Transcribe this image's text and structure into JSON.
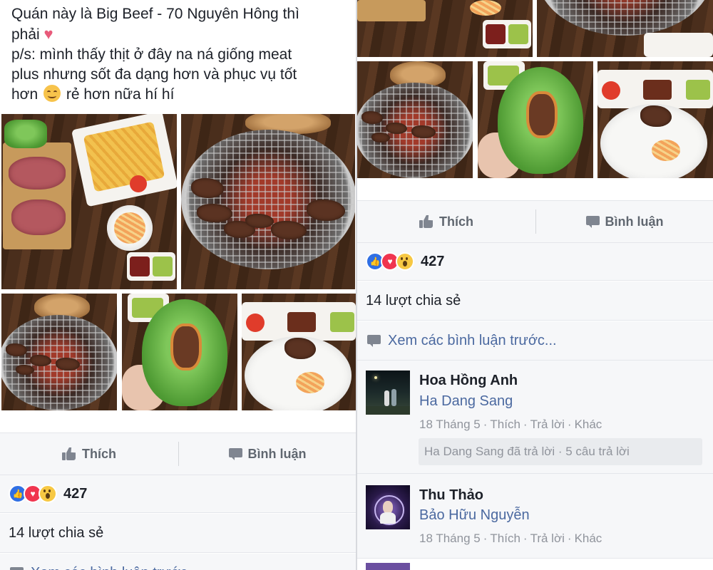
{
  "post": {
    "line1": "Quán này là Big Beef - 70 Nguyên Hông thì",
    "line2": "phải",
    "line3": "p/s: mình thấy thịt ở đây na ná giống meat",
    "line4": "plus nhưng sốt đa dạng hơn và phục vụ tốt",
    "line5_a": "hơn",
    "line5_b": "rẻ hơn nữa hí hí",
    "heart_emoji": "♥"
  },
  "actions": {
    "like_label": "Thích",
    "comment_label": "Bình luận"
  },
  "reactions": {
    "count": "427",
    "types": [
      "like",
      "love",
      "wow"
    ],
    "colors": {
      "like": "#2f6fe4",
      "love": "#f0354f",
      "wow": "#f7c843"
    }
  },
  "shares": {
    "text": "14 lượt chia sẻ"
  },
  "previous_comments": {
    "text": "Xem các bình luận trước..."
  },
  "comments": [
    {
      "name": "Hoa Hồng Anh",
      "tag": "Ha Dang Sang",
      "date": "18 Tháng 5",
      "like": "Thích",
      "reply": "Trả lời",
      "more": "Khác",
      "reply_summary": "Ha Dang Sang đã trả lời · 5 câu trả lời"
    },
    {
      "name": "Thu Thảo",
      "tag": "Bảo Hữu Nguyễn",
      "date": "18 Tháng 5",
      "like": "Thích",
      "reply": "Trả lời",
      "more": "Khác"
    }
  ],
  "colors": {
    "link": "#4b69a0",
    "muted": "#90949c",
    "accent": "#4267b2"
  }
}
